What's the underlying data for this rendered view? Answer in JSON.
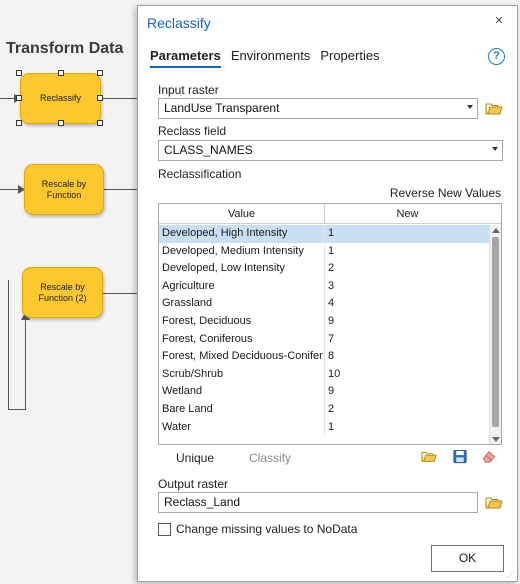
{
  "canvas": {
    "title": "Transform Data",
    "nodes": [
      {
        "label": "Reclassify"
      },
      {
        "label": "Rescale by Function"
      },
      {
        "label": "Rescale by Function (2)"
      }
    ]
  },
  "dialog": {
    "title": "Reclassify",
    "close_label": "×",
    "tabs": [
      "Parameters",
      "Environments",
      "Properties"
    ],
    "active_tab": "Parameters",
    "help_label": "?",
    "input_raster": {
      "label": "Input raster",
      "value": "LandUse Transparent"
    },
    "reclass_field": {
      "label": "Reclass field",
      "value": "CLASS_NAMES"
    },
    "reclassification": {
      "label": "Reclassification",
      "reverse_link": "Reverse New Values",
      "columns": [
        "Value",
        "New"
      ],
      "rows": [
        {
          "value": "Developed, High Intensity",
          "new": "1"
        },
        {
          "value": "Developed, Medium Intensity",
          "new": "1"
        },
        {
          "value": "Developed, Low Intensity",
          "new": "2"
        },
        {
          "value": "Agriculture",
          "new": "3"
        },
        {
          "value": "Grassland",
          "new": "4"
        },
        {
          "value": "Forest, Deciduous",
          "new": "9"
        },
        {
          "value": "Forest, Coniferous",
          "new": "7"
        },
        {
          "value": "Forest, Mixed Deciduous-Conifer",
          "new": "8"
        },
        {
          "value": "Scrub/Shrub",
          "new": "10"
        },
        {
          "value": "Wetland",
          "new": "9"
        },
        {
          "value": "Bare Land",
          "new": "2"
        },
        {
          "value": "Water",
          "new": "1"
        }
      ],
      "selected_row": 0
    },
    "unique_label": "Unique",
    "classify_label": "Classify",
    "output_raster": {
      "label": "Output raster",
      "value": "Reclass_Land"
    },
    "missing_values": {
      "label": "Change missing values to NoData",
      "checked": false
    },
    "ok_label": "OK",
    "colors": {
      "accent": "#1366c7",
      "node_fill": "#fdc72e",
      "selection": "#c9dff3"
    }
  }
}
